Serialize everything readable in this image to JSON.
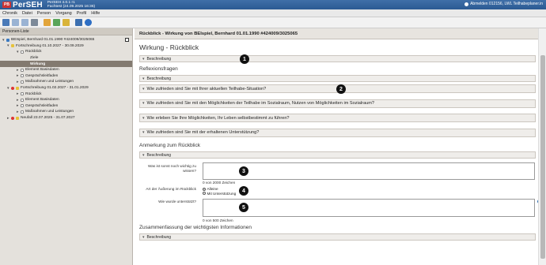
{
  "app": {
    "logo_text": "PB",
    "name": "PerSEH",
    "version_line1": "PerSEH 4.0.1 r1",
    "version_line2": "Fachtest (24.09.2025 16:36)",
    "user": "Abmelden 012156, LWL Teilhabeplaner.in"
  },
  "menu": [
    "Chronik",
    "Datei",
    "Person",
    "Vorgang",
    "Profil",
    "Hilfe"
  ],
  "toolbar_icons": [
    "save-icon",
    "undo-icon",
    "redo-icon",
    "print-icon",
    "person-icon",
    "add-icon",
    "lock-icon",
    "user-icon",
    "help-icon"
  ],
  "left_panel": {
    "header": "Personen-Liste",
    "items": [
      {
        "label": "BEIspiel, Bernhard 01.01.1990 #424009/3025065",
        "level": 0
      },
      {
        "label": "Fortschreibung 01.10.2027 - 30.09.2029",
        "level": 1
      },
      {
        "label": "Rückblick",
        "level": 2
      },
      {
        "label": "Ziele",
        "level": 3
      },
      {
        "label": "Wirkung",
        "level": 3,
        "active": true
      },
      {
        "label": "Element Basisdaten",
        "level": 2
      },
      {
        "label": "Gesprächsleitfaden",
        "level": 2
      },
      {
        "label": "Maßnahmen und Leistungen",
        "level": 2
      },
      {
        "label": "Fortschreibung 01.02.2027 - 31.01.2029",
        "level": 1
      },
      {
        "label": "Rückblick",
        "level": 2
      },
      {
        "label": "Element Basisdaten",
        "level": 2
      },
      {
        "label": "Gesprächsleitfaden",
        "level": 2
      },
      {
        "label": "Maßnahmen und Leistungen",
        "level": 2
      },
      {
        "label": "Neufall 23.07.2025 - 31.07.2027",
        "level": 1
      }
    ]
  },
  "main": {
    "header": "Rückblick - Wirkung von BEIspiel, Bernhard 01.01.1990 #424009/3025065",
    "title": "Wirkung - Rückblick",
    "beschreibung": "Beschreibung",
    "reflexion_title": "Reflexionsfragen",
    "questions": [
      "Wie zufrieden sind Sie mit Ihrer aktuellen Teilhabe-Situation?",
      "Wie zufrieden sind Sie mit den Möglichkeiten der Teilhabe im Sozialraum, Nutzen von Möglichkeiten im Sozialraum?",
      "Wie erleben Sie Ihre Möglichkeiten, Ihr Leben selbstbestimmt zu führen?",
      "Wie zufrieden sind Sie mit der erhaltenen Unterstützung?"
    ],
    "anmerkung_title": "Anmerkung zum Rückblick",
    "field1_label": "Was ist sonst noch wichtig zu wissen?",
    "field1_counter": "0 von 2000 Zeichen",
    "radio_label": "Art der Äußerung im Rückblick",
    "radio_options": [
      "Alleine",
      "Mit Unterstützung"
    ],
    "field2_label": "Wie wurde unterstützt?",
    "field2_counter": "0 von 500 Zeichen",
    "summary_title": "Zusammenfassung der wichtigsten Informationen"
  },
  "markers": [
    "1",
    "2",
    "3",
    "4",
    "5"
  ],
  "colors": {
    "titlebar": "#2b5a93",
    "tree_active": "#837a70",
    "panel_bg": "#e4e1dc"
  }
}
